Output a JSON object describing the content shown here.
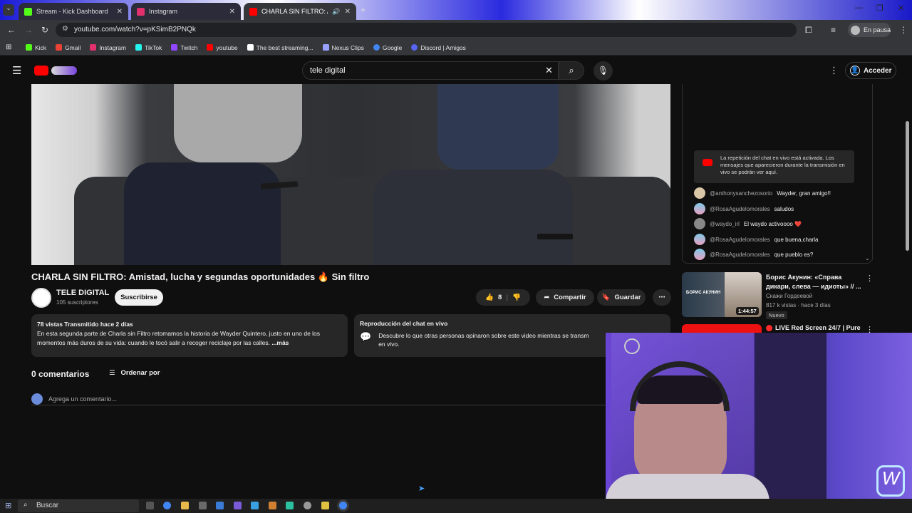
{
  "browser": {
    "tabs": [
      {
        "label": "Stream - Kick Dashboard",
        "color": "#53fc18"
      },
      {
        "label": "Instagram",
        "color": "#e1306c"
      },
      {
        "label": "CHARLA SIN FILTRO: Amist",
        "color": "#ff0000"
      }
    ],
    "new_tab": "+",
    "url": "youtube.com/watch?v=pKSimB2PNQk",
    "profile_status": "En pausa",
    "bookmarks": [
      {
        "label": "Kick",
        "color": "#53fc18"
      },
      {
        "label": "Gmail",
        "color": "#ea4335"
      },
      {
        "label": "Instagram",
        "color": "#e1306c"
      },
      {
        "label": "TikTok",
        "color": "#25f4ee"
      },
      {
        "label": "Twitch",
        "color": "#9146ff"
      },
      {
        "label": "youtube",
        "color": "#ff0000"
      },
      {
        "label": "The best streaming...",
        "color": "#ffffff"
      },
      {
        "label": "Nexus Clips",
        "color": "#9aa0ff"
      },
      {
        "label": "Google",
        "color": "#4285f4"
      },
      {
        "label": "Discord | Amigos",
        "color": "#5865f2"
      }
    ]
  },
  "youtube": {
    "search_value": "tele digital",
    "sign_in": "Acceder",
    "video_title": "CHARLA SIN FILTRO: Amistad, lucha y segundas oportunidades 🔥 Sin filtro",
    "channel": {
      "name": "TELE DIGITAL",
      "subs": "105 suscriptores",
      "subscribe": "Suscribirse"
    },
    "actions": {
      "likes": "8",
      "share": "Compartir",
      "save": "Guardar",
      "more": "⋯"
    },
    "description": {
      "meta": "78 vistas  Transmitido hace 2 días",
      "text": "En esta segunda parte de Charla sin Filtro retomamos la historia de Wayder Quintero, justo en uno de los momentos más duros de su vida: cuando le tocó salir a recoger reciclaje por las calles.",
      "more": "...más"
    },
    "chat_replay": {
      "title": "Reproducción del chat en vivo",
      "text": "Descubre lo que otras personas opinaron sobre este video mientras se transm",
      "text2": "en vivo."
    },
    "comments": {
      "count": "0 comentarios",
      "sort": "Ordenar por",
      "placeholder": "Agrega un comentario..."
    },
    "live_chat": {
      "notice": "La repetición del chat en vivo está activada. Los mensajes que aparecieron durante la transmisión en vivo se podrán ver aquí.",
      "messages": [
        {
          "author": "@anthonysanchezosorio",
          "text": "Wayder, gran amigo!!"
        },
        {
          "author": "@RosaAgudelomorales",
          "text": "saludos"
        },
        {
          "author": "@waydo_irl",
          "text": "El waydo activoooo ❤️"
        },
        {
          "author": "@RosaAgudelomorales",
          "text": "que buena,charla"
        },
        {
          "author": "@RosaAgudelomorales",
          "text": "que pueblo es?"
        }
      ]
    },
    "recommendations": [
      {
        "title": "Борис Акунин: «Справа дикари, слева — идиоты» // ...",
        "channel": "Скажи Гордеевой",
        "stats": "817 k vistas · hace 3 días",
        "badge": "Nuevo",
        "duration": "1:44:57",
        "thumb_text": "БОРИС АКУНИН"
      },
      {
        "title": "LIVE Red Screen 24/7 | Pure"
      }
    ]
  },
  "taskbar": {
    "search": "Buscar"
  }
}
